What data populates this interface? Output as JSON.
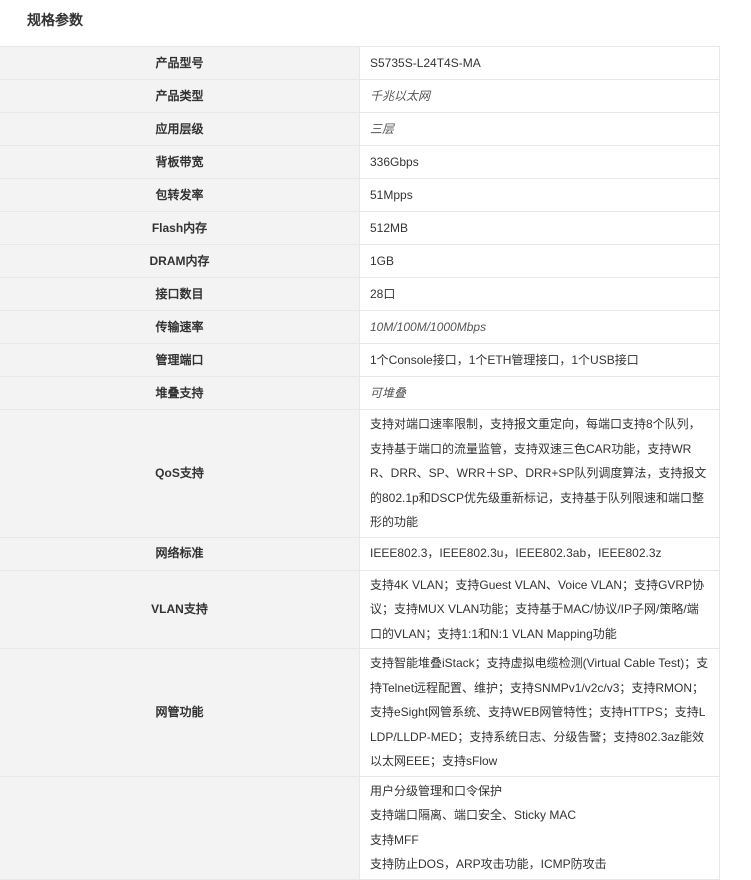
{
  "title": "规格参数",
  "rows": [
    {
      "key": "产品型号",
      "value": "S5735S-L24T4S-MA",
      "italic": false
    },
    {
      "key": "产品类型",
      "value": "千兆以太网",
      "italic": true
    },
    {
      "key": "应用层级",
      "value": "三层",
      "italic": true
    },
    {
      "key": "背板带宽",
      "value": "336Gbps",
      "italic": false
    },
    {
      "key": "包转发率",
      "value": "51Mpps",
      "italic": false
    },
    {
      "key": "Flash内存",
      "value": "512MB",
      "italic": false
    },
    {
      "key": "DRAM内存",
      "value": "1GB",
      "italic": false
    },
    {
      "key": "接口数目",
      "value": "28口",
      "italic": false
    },
    {
      "key": "传输速率",
      "value": "10M/100M/1000Mbps",
      "italic": true
    },
    {
      "key": "管理端口",
      "value": "1个Console接口，1个ETH管理接口，1个USB接口",
      "italic": false
    },
    {
      "key": "堆叠支持",
      "value": "可堆叠",
      "italic": true
    }
  ],
  "qos": {
    "key": "QoS支持",
    "lines": [
      "支持对端口速率限制，支持报文重定向，每端口支持8个队列，",
      "支持基于端口的流量监管，支持双速三色CAR功能，支持WR",
      "R、DRR、SP、WRR＋SP、DRR+SP队列调度算法，支持报文",
      "的802.1p和DSCP优先级重新标记，支持基于队列限速和端口整",
      "形的功能"
    ]
  },
  "network": {
    "key": "网络标准",
    "value": "IEEE802.3，IEEE802.3u，IEEE802.3ab，IEEE802.3z"
  },
  "vlan": {
    "key": "VLAN支持",
    "lines": [
      "支持4K VLAN；支持Guest VLAN、Voice VLAN；支持GVRP协",
      "议；支持MUX VLAN功能；支持基于MAC/协议/IP子网/策略/端",
      "口的VLAN；支持1:1和N:1 VLAN Mapping功能"
    ]
  },
  "mgmt": {
    "key": "网管功能",
    "lines": [
      "支持智能堆叠iStack；支持虚拟电缆检测(Virtual Cable Test)；支",
      "持Telnet远程配置、维护；支持SNMPv1/v2c/v3；支持RMON；",
      "支持eSight网管系统、支持WEB网管特性；支持HTTPS；支持L",
      "LDP/LLDP-MED；支持系统日志、分级告警；支持802.3az能效",
      "以太网EEE；支持sFlow"
    ]
  },
  "security": {
    "key": "",
    "lines": [
      "用户分级管理和口令保护",
      "支持端口隔离、端口安全、Sticky MAC",
      "支持MFF",
      "支持防止DOS，ARP攻击功能，ICMP防攻击"
    ]
  }
}
